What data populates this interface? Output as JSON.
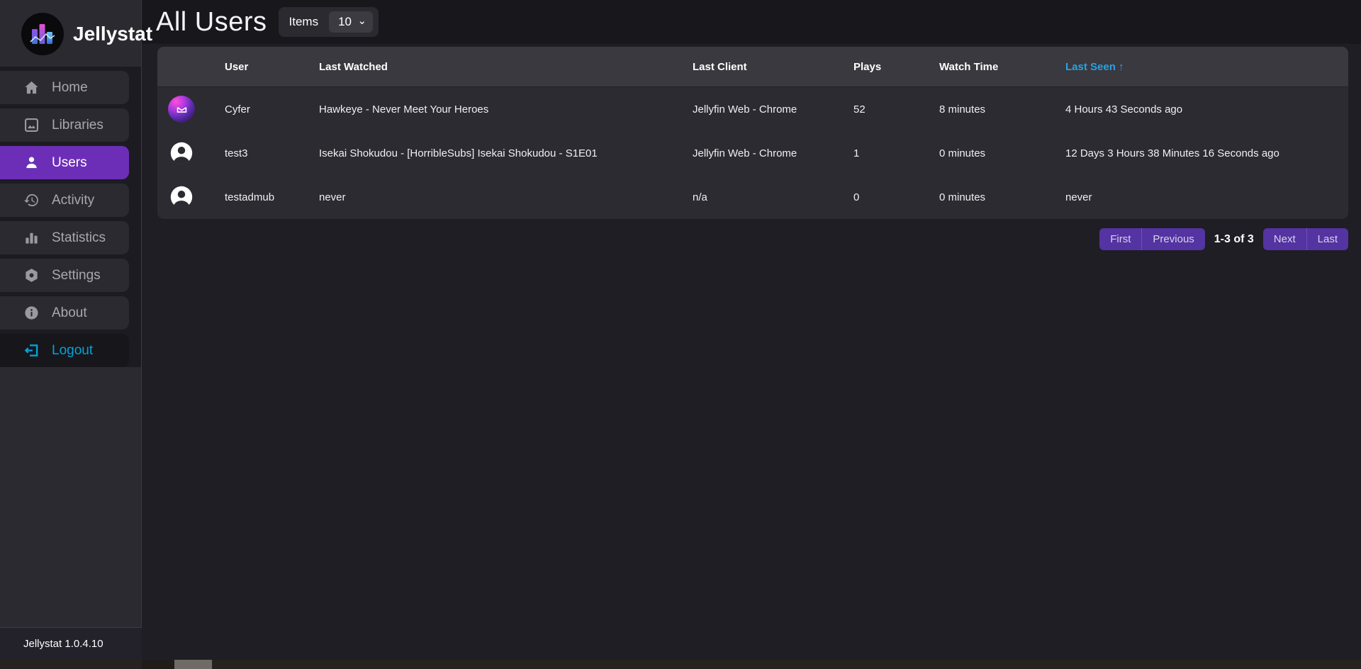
{
  "app": {
    "name": "Jellystat",
    "version_label": "Jellystat 1.0.4.10"
  },
  "sidebar": {
    "items": [
      {
        "label": "Home",
        "icon": "home-icon",
        "active": false
      },
      {
        "label": "Libraries",
        "icon": "libraries-icon",
        "active": false
      },
      {
        "label": "Users",
        "icon": "users-icon",
        "active": true
      },
      {
        "label": "Activity",
        "icon": "activity-history-icon",
        "active": false
      },
      {
        "label": "Statistics",
        "icon": "statistics-icon",
        "active": false
      },
      {
        "label": "Settings",
        "icon": "settings-icon",
        "active": false
      },
      {
        "label": "About",
        "icon": "about-icon",
        "active": false
      }
    ],
    "logout": {
      "label": "Logout",
      "icon": "logout-icon"
    }
  },
  "header": {
    "title": "All Users",
    "items_label": "Items",
    "items_per_page": "10"
  },
  "table": {
    "headers": [
      "User",
      "Last Watched",
      "Last Client",
      "Plays",
      "Watch Time",
      "Last Seen"
    ],
    "sort": {
      "column": "Last Seen",
      "direction": "asc",
      "arrow": "↑"
    },
    "rows": [
      {
        "user": "Cyfer",
        "avatar": "custom-gradient-logo",
        "last_watched": "Hawkeye - Never Meet Your Heroes",
        "last_client": "Jellyfin Web - Chrome",
        "plays": "52",
        "watch_time": "8 minutes",
        "last_seen": "4 Hours 43 Seconds ago"
      },
      {
        "user": "test3",
        "avatar": "default-person",
        "last_watched": "Isekai Shokudou - [HorribleSubs] Isekai Shokudou - S1E01",
        "last_client": "Jellyfin Web - Chrome",
        "plays": "1",
        "watch_time": "0 minutes",
        "last_seen": "12 Days 3 Hours 38 Minutes 16 Seconds ago"
      },
      {
        "user": "testadmub",
        "avatar": "default-person",
        "last_watched": "never",
        "last_client": "n/a",
        "plays": "0",
        "watch_time": "0 minutes",
        "last_seen": "never"
      }
    ]
  },
  "pagination": {
    "first": "First",
    "previous": "Previous",
    "range": "1-3 of 3",
    "next": "Next",
    "last": "Last"
  },
  "colors": {
    "sidebar_active_purple": "#6c2eb7",
    "pagination_purple": "#5433a2",
    "logout_cyan": "#00a4dc",
    "sort_cyan": "#2aa2e2"
  }
}
